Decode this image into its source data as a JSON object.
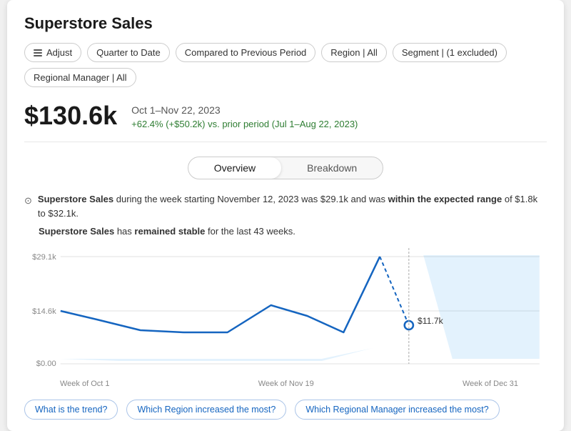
{
  "page": {
    "title": "Superstore Sales"
  },
  "toolbar": {
    "adjust_label": "Adjust",
    "quarter_label": "Quarter to Date",
    "compared_label": "Compared to Previous Period",
    "region_label": "Region | All",
    "segment_label": "Segment | (1 excluded)",
    "regional_manager_label": "Regional Manager | All"
  },
  "metric": {
    "value": "$130.6k",
    "period": "Oct 1–Nov 22, 2023",
    "change": "+62.4% (+$50.2k) vs. prior period (Jul 1–Aug 22, 2023)"
  },
  "tabs": {
    "overview_label": "Overview",
    "breakdown_label": "Breakdown"
  },
  "insights": {
    "line1_prefix": " during the week starting November 12, 2023 was $29.1k and was ",
    "line1_bold1": "Superstore Sales",
    "line1_bold2": "within the expected range",
    "line1_suffix": " of $1.8k to $32.1k.",
    "line2_prefix": " has ",
    "line2_bold1": "Superstore Sales",
    "line2_bold2": "remained stable",
    "line2_suffix": " for the last 43 weeks."
  },
  "chart": {
    "y_labels": [
      "$29.1k",
      "$14.6k",
      "$0.00"
    ],
    "x_labels": [
      "Week of Oct 1",
      "Week of Nov 19",
      "Week of Dec 31"
    ],
    "data_label": "$11.7k"
  },
  "questions": [
    "What is the trend?",
    "Which Region increased the most?",
    "Which Regional Manager increased the most?"
  ],
  "colors": {
    "accent_blue": "#1565c0",
    "positive_green": "#2e7d32",
    "line_color": "#1976d2",
    "band_fill": "rgba(100,181,246,0.2)"
  }
}
